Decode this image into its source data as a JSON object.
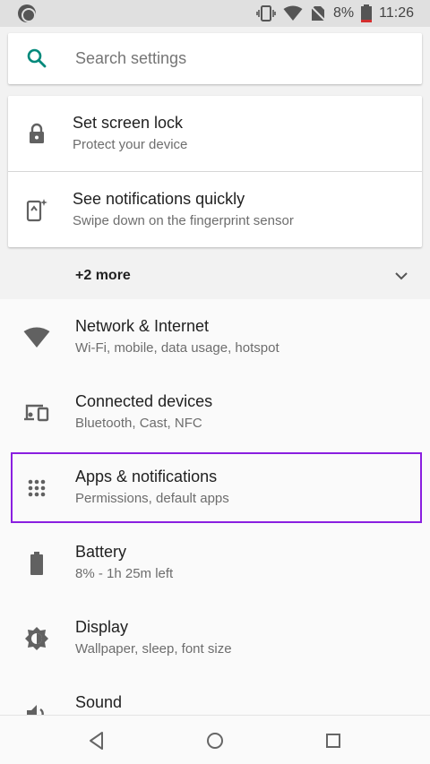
{
  "status_bar": {
    "battery_percent": "8%",
    "time": "11:26",
    "icons": [
      "app-notification-icon",
      "vibrate-icon",
      "wifi-icon",
      "no-sim-icon",
      "battery-low-icon"
    ],
    "battery_color": "#d32f2f"
  },
  "search": {
    "placeholder": "Search settings",
    "icon": "search-icon",
    "accent": "#00897b"
  },
  "suggestions": {
    "items": [
      {
        "title": "Set screen lock",
        "subtitle": "Protect your device",
        "icon": "lock-icon"
      },
      {
        "title": "See notifications quickly",
        "subtitle": "Swipe down on the fingerprint sensor",
        "icon": "fingerprint-gesture-icon"
      }
    ],
    "more_label": "+2 more"
  },
  "settings": {
    "items": [
      {
        "title": "Network & Internet",
        "subtitle": "Wi-Fi, mobile, data usage, hotspot",
        "icon": "wifi-icon"
      },
      {
        "title": "Connected devices",
        "subtitle": "Bluetooth, Cast, NFC",
        "icon": "devices-icon"
      },
      {
        "title": "Apps & notifications",
        "subtitle": "Permissions, default apps",
        "icon": "apps-grid-icon"
      },
      {
        "title": "Battery",
        "subtitle": "8% - 1h 25m left",
        "icon": "battery-icon"
      },
      {
        "title": "Display",
        "subtitle": "Wallpaper, sleep, font size",
        "icon": "brightness-icon"
      },
      {
        "title": "Sound",
        "subtitle": "",
        "icon": "volume-icon"
      }
    ],
    "highlight_color": "#8a1fe0"
  },
  "nav_bar": {
    "buttons": [
      "back-icon",
      "home-icon",
      "recents-icon"
    ]
  }
}
